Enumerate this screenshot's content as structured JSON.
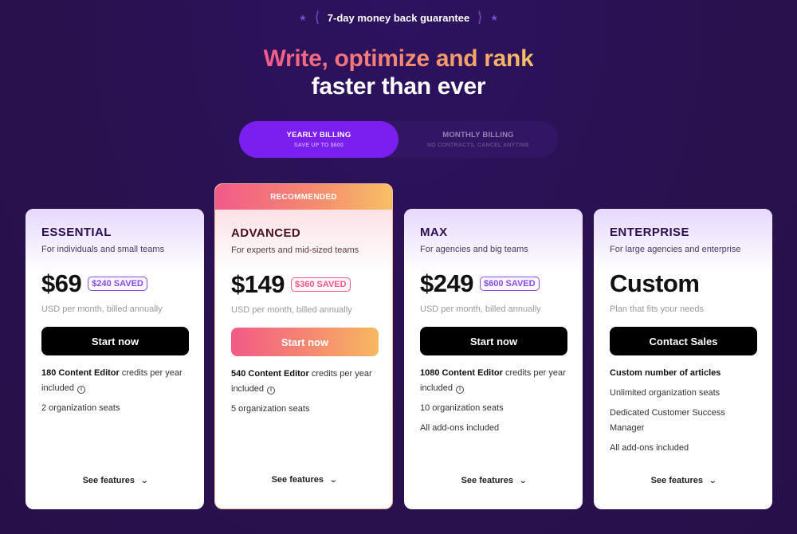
{
  "guarantee": {
    "text": "7-day money back guarantee",
    "left_star": "★",
    "right_star": "★",
    "laurel_left": "⟨",
    "laurel_right": "⟩"
  },
  "headline": {
    "line1": "Write, optimize and rank",
    "line2": "faster than ever",
    "gradient_colors": [
      "#f25a8a",
      "#f5896f",
      "#f7c064"
    ]
  },
  "billing": {
    "selected": "yearly",
    "yearly": {
      "title": "YEARLY BILLING",
      "subtitle": "SAVE UP TO $600"
    },
    "monthly": {
      "title": "MONTHLY BILLING",
      "subtitle": "NO CONTRACTS, CANCEL ANYTIME"
    }
  },
  "colors": {
    "background": "#29114e",
    "accent_purple": "#7a1ff0",
    "saved_purple": "#8a4ae8",
    "saved_pink": "#ee5a88"
  },
  "plans": [
    {
      "name": "ESSENTIAL",
      "description": "For individuals and small teams",
      "price": "$69",
      "saved": "$240 SAVED",
      "price_note": "USD per month, billed annually",
      "cta": "Start now",
      "features": [
        {
          "bold": "180 Content Editor",
          "text": " credits per year included",
          "info": true
        },
        {
          "bold": "",
          "text": "2 organization seats",
          "info": false
        }
      ],
      "see_features": "See features"
    },
    {
      "name": "ADVANCED",
      "recommended": "RECOMMENDED",
      "description": "For experts and mid-sized teams",
      "price": "$149",
      "saved": "$360 SAVED",
      "price_note": "USD per month, billed annually",
      "cta": "Start now",
      "features": [
        {
          "bold": "540 Content Editor",
          "text": " credits per year included",
          "info": true
        },
        {
          "bold": "",
          "text": "5 organization seats",
          "info": false
        }
      ],
      "see_features": "See features"
    },
    {
      "name": "MAX",
      "description": "For agencies and big teams",
      "price": "$249",
      "saved": "$600 SAVED",
      "price_note": "USD per month, billed annually",
      "cta": "Start now",
      "features": [
        {
          "bold": "1080 Content Editor",
          "text": " credits per year included",
          "info": true
        },
        {
          "bold": "",
          "text": "10 organization seats",
          "info": false
        },
        {
          "bold": "",
          "text": "All add-ons included",
          "info": false
        }
      ],
      "see_features": "See features"
    },
    {
      "name": "ENTERPRISE",
      "description": "For large agencies and enterprise",
      "price": "Custom",
      "saved": "",
      "price_note": "Plan that fits your needs",
      "cta": "Contact Sales",
      "features": [
        {
          "bold": "Custom number of articles",
          "text": "",
          "info": false
        },
        {
          "bold": "",
          "text": "Unlimited organization seats",
          "info": false
        },
        {
          "bold": "",
          "text": "Dedicated Customer Success Manager",
          "info": false
        },
        {
          "bold": "",
          "text": "All add-ons included",
          "info": false
        }
      ],
      "see_features": "See features"
    }
  ],
  "icons": {
    "info": "i",
    "chevron_down": "⌄"
  }
}
